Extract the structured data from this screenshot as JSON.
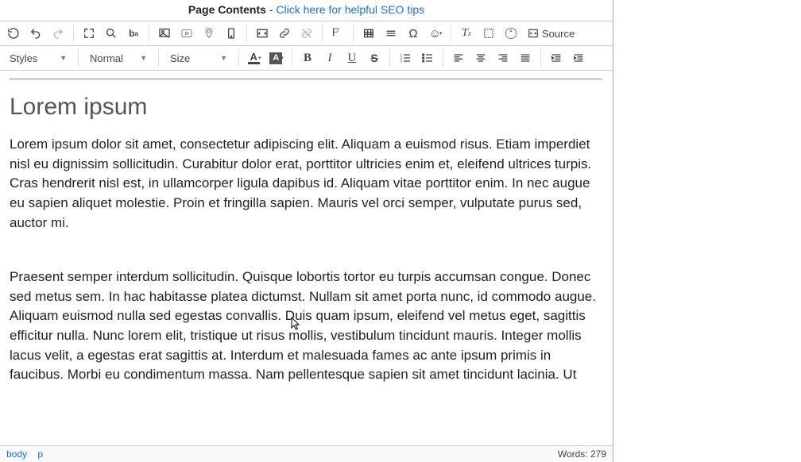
{
  "header": {
    "label": "Page Contents",
    "sep": " - ",
    "link": "Click here for helpful SEO tips"
  },
  "toolbar": {
    "source": "Source",
    "styles": "Styles",
    "format": "Normal",
    "size": "Size"
  },
  "content": {
    "heading": "Lorem ipsum",
    "p1": "Lorem ipsum dolor sit amet, consectetur adipiscing elit. Aliquam a euismod risus. Etiam imperdiet nisl eu dignissim sollicitudin. Curabitur dolor erat, porttitor ultricies enim et, eleifend ultrices turpis. Cras hendrerit nisl est, in ullamcorper ligula dapibus id. Aliquam vitae porttitor enim. In nec augue eu sapien aliquet molestie. Proin et fringilla sapien. Mauris vel orci semper, vulputate purus sed, auctor mi.",
    "p2": "Praesent semper interdum sollicitudin. Quisque lobortis tortor eu turpis accumsan congue. Donec sed metus sem. In hac habitasse platea dictumst. Nullam sit amet porta nunc, id commodo augue. Aliquam euismod nulla sed egestas convallis. Duis quam ipsum, eleifend vel metus eget, sagittis efficitur nulla. Nunc lorem elit, tristique ut risus mollis, vestibulum tincidunt mauris. Integer mollis lacus velit, a egestas erat sagittis at. Interdum et malesuada fames ac ante ipsum primis in faucibus. Morbi eu condimentum massa. Nam pellentesque sapien sit amet tincidunt lacinia. Ut"
  },
  "footer": {
    "path": [
      "body",
      "p"
    ],
    "words_label": "Words:",
    "words": 279
  }
}
